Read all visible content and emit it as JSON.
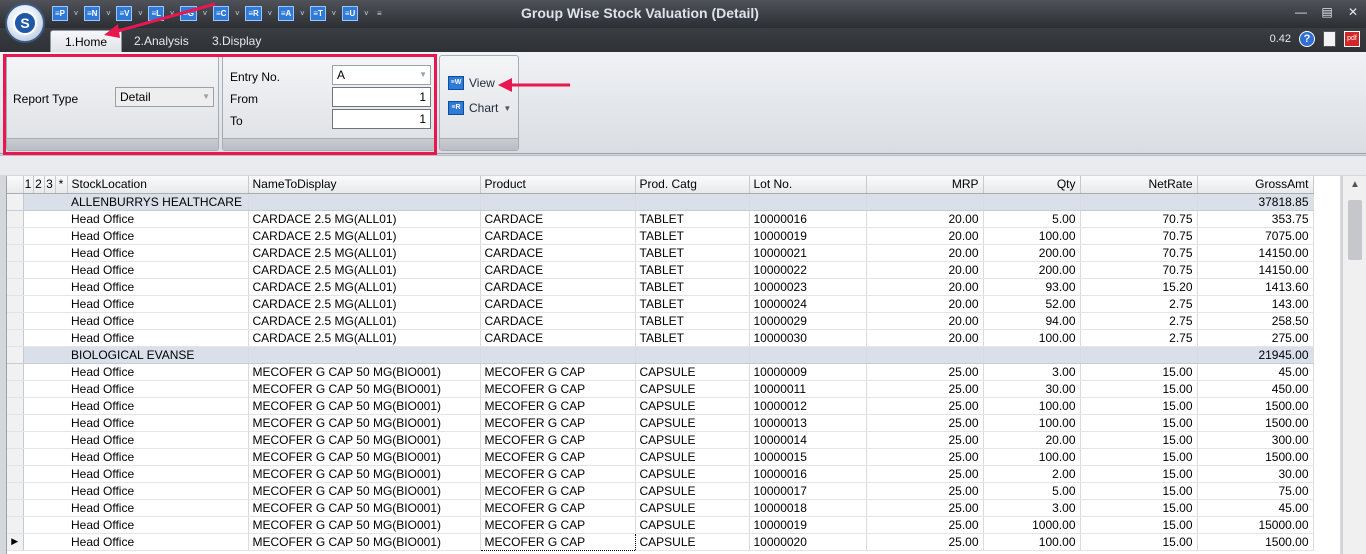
{
  "window": {
    "title": "Group Wise Stock Valuation (Detail)",
    "version": "0.42"
  },
  "app_logo": "S",
  "quick_access": [
    {
      "label": "≡P",
      "icon": "report-p-icon"
    },
    {
      "label": "≡N",
      "icon": "report-n-icon"
    },
    {
      "label": "≡V",
      "icon": "report-v-icon"
    },
    {
      "label": "≡L",
      "icon": "report-l-icon"
    },
    {
      "label": "≡G",
      "icon": "report-g-icon"
    },
    {
      "label": "≡C",
      "icon": "report-c-icon"
    },
    {
      "label": "≡R",
      "icon": "report-r-icon"
    },
    {
      "label": "≡A",
      "icon": "report-a-icon"
    },
    {
      "label": "≡T",
      "icon": "report-t-icon"
    },
    {
      "label": "≡U",
      "icon": "report-u-icon"
    }
  ],
  "tabs": [
    "1.Home",
    "2.Analysis",
    "3.Display"
  ],
  "ribbon": {
    "report_type_label": "Report Type",
    "report_type_value": "Detail",
    "entry_no_label": "Entry No.",
    "entry_no_value": "A",
    "from_label": "From",
    "from_value": "1",
    "to_label": "To",
    "to_value": "1",
    "view_label": "View",
    "chart_label": "Chart"
  },
  "grid": {
    "selectors": [
      "1",
      "2",
      "3",
      "*"
    ],
    "columns": [
      "StockLocation",
      "NameToDisplay",
      "Product",
      "Prod. Catg",
      "Lot No.",
      "MRP",
      "Qty",
      "NetRate",
      "GrossAmt"
    ],
    "rows": [
      {
        "group": "ALLENBURRYS HEALTHCARE",
        "total": "37818.85"
      },
      {
        "cells": [
          "Head Office",
          "CARDACE 2.5 MG(ALL01)",
          "CARDACE",
          "TABLET",
          "10000016",
          "20.00",
          "5.00",
          "70.75",
          "353.75"
        ]
      },
      {
        "cells": [
          "Head Office",
          "CARDACE 2.5 MG(ALL01)",
          "CARDACE",
          "TABLET",
          "10000019",
          "20.00",
          "100.00",
          "70.75",
          "7075.00"
        ]
      },
      {
        "cells": [
          "Head Office",
          "CARDACE 2.5 MG(ALL01)",
          "CARDACE",
          "TABLET",
          "10000021",
          "20.00",
          "200.00",
          "70.75",
          "14150.00"
        ]
      },
      {
        "cells": [
          "Head Office",
          "CARDACE 2.5 MG(ALL01)",
          "CARDACE",
          "TABLET",
          "10000022",
          "20.00",
          "200.00",
          "70.75",
          "14150.00"
        ]
      },
      {
        "cells": [
          "Head Office",
          "CARDACE 2.5 MG(ALL01)",
          "CARDACE",
          "TABLET",
          "10000023",
          "20.00",
          "93.00",
          "15.20",
          "1413.60"
        ]
      },
      {
        "cells": [
          "Head Office",
          "CARDACE 2.5 MG(ALL01)",
          "CARDACE",
          "TABLET",
          "10000024",
          "20.00",
          "52.00",
          "2.75",
          "143.00"
        ]
      },
      {
        "cells": [
          "Head Office",
          "CARDACE 2.5 MG(ALL01)",
          "CARDACE",
          "TABLET",
          "10000029",
          "20.00",
          "94.00",
          "2.75",
          "258.50"
        ]
      },
      {
        "cells": [
          "Head Office",
          "CARDACE 2.5 MG(ALL01)",
          "CARDACE",
          "TABLET",
          "10000030",
          "20.00",
          "100.00",
          "2.75",
          "275.00"
        ]
      },
      {
        "group": "BIOLOGICAL EVANSE",
        "total": "21945.00"
      },
      {
        "cells": [
          "Head Office",
          "MECOFER G CAP 50 MG(BIO001)",
          "MECOFER G CAP",
          "CAPSULE",
          "10000009",
          "25.00",
          "3.00",
          "15.00",
          "45.00"
        ]
      },
      {
        "cells": [
          "Head Office",
          "MECOFER G CAP 50 MG(BIO001)",
          "MECOFER G CAP",
          "CAPSULE",
          "10000011",
          "25.00",
          "30.00",
          "15.00",
          "450.00"
        ]
      },
      {
        "cells": [
          "Head Office",
          "MECOFER G CAP 50 MG(BIO001)",
          "MECOFER G CAP",
          "CAPSULE",
          "10000012",
          "25.00",
          "100.00",
          "15.00",
          "1500.00"
        ]
      },
      {
        "cells": [
          "Head Office",
          "MECOFER G CAP 50 MG(BIO001)",
          "MECOFER G CAP",
          "CAPSULE",
          "10000013",
          "25.00",
          "100.00",
          "15.00",
          "1500.00"
        ]
      },
      {
        "cells": [
          "Head Office",
          "MECOFER G CAP 50 MG(BIO001)",
          "MECOFER G CAP",
          "CAPSULE",
          "10000014",
          "25.00",
          "20.00",
          "15.00",
          "300.00"
        ]
      },
      {
        "cells": [
          "Head Office",
          "MECOFER G CAP 50 MG(BIO001)",
          "MECOFER G CAP",
          "CAPSULE",
          "10000015",
          "25.00",
          "100.00",
          "15.00",
          "1500.00"
        ]
      },
      {
        "cells": [
          "Head Office",
          "MECOFER G CAP 50 MG(BIO001)",
          "MECOFER G CAP",
          "CAPSULE",
          "10000016",
          "25.00",
          "2.00",
          "15.00",
          "30.00"
        ]
      },
      {
        "cells": [
          "Head Office",
          "MECOFER G CAP 50 MG(BIO001)",
          "MECOFER G CAP",
          "CAPSULE",
          "10000017",
          "25.00",
          "5.00",
          "15.00",
          "75.00"
        ]
      },
      {
        "cells": [
          "Head Office",
          "MECOFER G CAP 50 MG(BIO001)",
          "MECOFER G CAP",
          "CAPSULE",
          "10000018",
          "25.00",
          "3.00",
          "15.00",
          "45.00"
        ]
      },
      {
        "cells": [
          "Head Office",
          "MECOFER G CAP 50 MG(BIO001)",
          "MECOFER G CAP",
          "CAPSULE",
          "10000019",
          "25.00",
          "1000.00",
          "15.00",
          "15000.00"
        ]
      },
      {
        "cells": [
          "Head Office",
          "MECOFER G CAP 50 MG(BIO001)",
          "MECOFER G CAP",
          "CAPSULE",
          "10000020",
          "25.00",
          "100.00",
          "15.00",
          "1500.00"
        ],
        "current": true
      }
    ]
  },
  "colors": {
    "highlight": "#e8174f",
    "group_row": "#d9e0ea",
    "accent": "#2e7ad6"
  }
}
